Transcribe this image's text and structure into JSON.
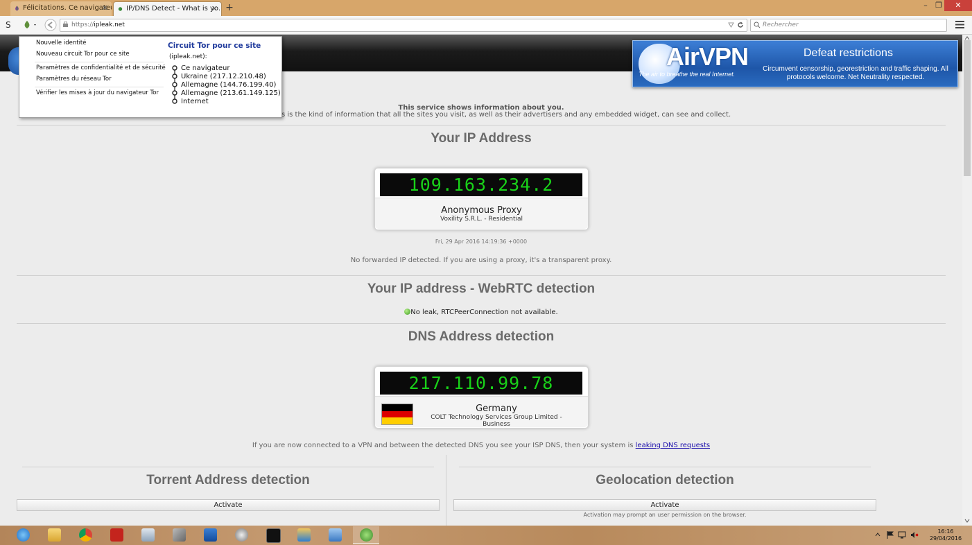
{
  "browser": {
    "tabs": [
      {
        "title": "Félicitations. Ce navigateur...",
        "active": false
      },
      {
        "title": "IP/DNS Detect - What is yo...",
        "active": true
      }
    ],
    "new_tab_symbol": "+",
    "url_scheme": "https://",
    "url_host": "ipleak.net",
    "search_placeholder": "Rechercher",
    "window_controls": {
      "minimize": "–",
      "maximize": "❐",
      "close": "✕"
    }
  },
  "tor_menu": {
    "items": [
      "Nouvelle identité",
      "Nouveau circuit Tor pour ce site",
      "Paramètres de confidentialité et de sécurité",
      "Paramètres du réseau Tor",
      "Vérifier les mises à jour du navigateur Tor"
    ],
    "circuit_title": "Circuit Tor pour ce site",
    "circuit_site": "(ipleak.net):",
    "circuit_nodes": [
      "Ce navigateur",
      "Ukraine (217.12.210.48)",
      "Allemagne (144.76.199.40)",
      "Allemagne (213.61.149.125)",
      "Internet"
    ]
  },
  "banner": {
    "logo": "AirVPN",
    "tagline": "The air to breathe the real Internet.",
    "headline": "Defeat restrictions",
    "subtext": "Circumvent censorship, georestriction and traffic shaping. All protocols welcome. Net Neutrality respected."
  },
  "intro": {
    "line1": "This service shows information about you.",
    "line2": "s is the kind of information that all the sites you visit, as well as their advertisers and any embedded widget, can see and collect."
  },
  "ip_section": {
    "heading": "Your IP Address",
    "ip": "109.163.234.2",
    "type": "Anonymous Proxy",
    "isp": "Voxility S.R.L. - Residential",
    "timestamp": "Fri, 29 Apr 2016 14:19:36 +0000",
    "forwarded_note": "No forwarded IP detected. If you are using a proxy, it's a transparent proxy."
  },
  "webrtc_section": {
    "heading": "Your IP address - WebRTC detection",
    "status": "No leak, RTCPeerConnection not available."
  },
  "dns_section": {
    "heading": "DNS Address detection",
    "ip": "217.110.99.78",
    "country": "Germany",
    "isp": "COLT Technology Services Group Limited - Business",
    "note": "If you are now connected to a VPN and between the detected DNS you see your ISP DNS, then your system is",
    "link": "leaking DNS requests"
  },
  "torrent_section": {
    "heading": "Torrent Address detection",
    "button": "Activate"
  },
  "geo_section": {
    "heading": "Geolocation detection",
    "button": "Activate",
    "note": "Activation may prompt an user permission on the browser."
  },
  "taskbar": {
    "icons": [
      "internet-explorer-icon",
      "file-explorer-icon",
      "chrome-icon",
      "acrobat-icon",
      "photos-icon",
      "tools-icon",
      "wifi-icon",
      "globe-icon",
      "cmd-icon",
      "app-icon",
      "remote-desktop-icon",
      "tor-browser-icon"
    ],
    "time": "16:16",
    "date": "29/04/2016"
  }
}
